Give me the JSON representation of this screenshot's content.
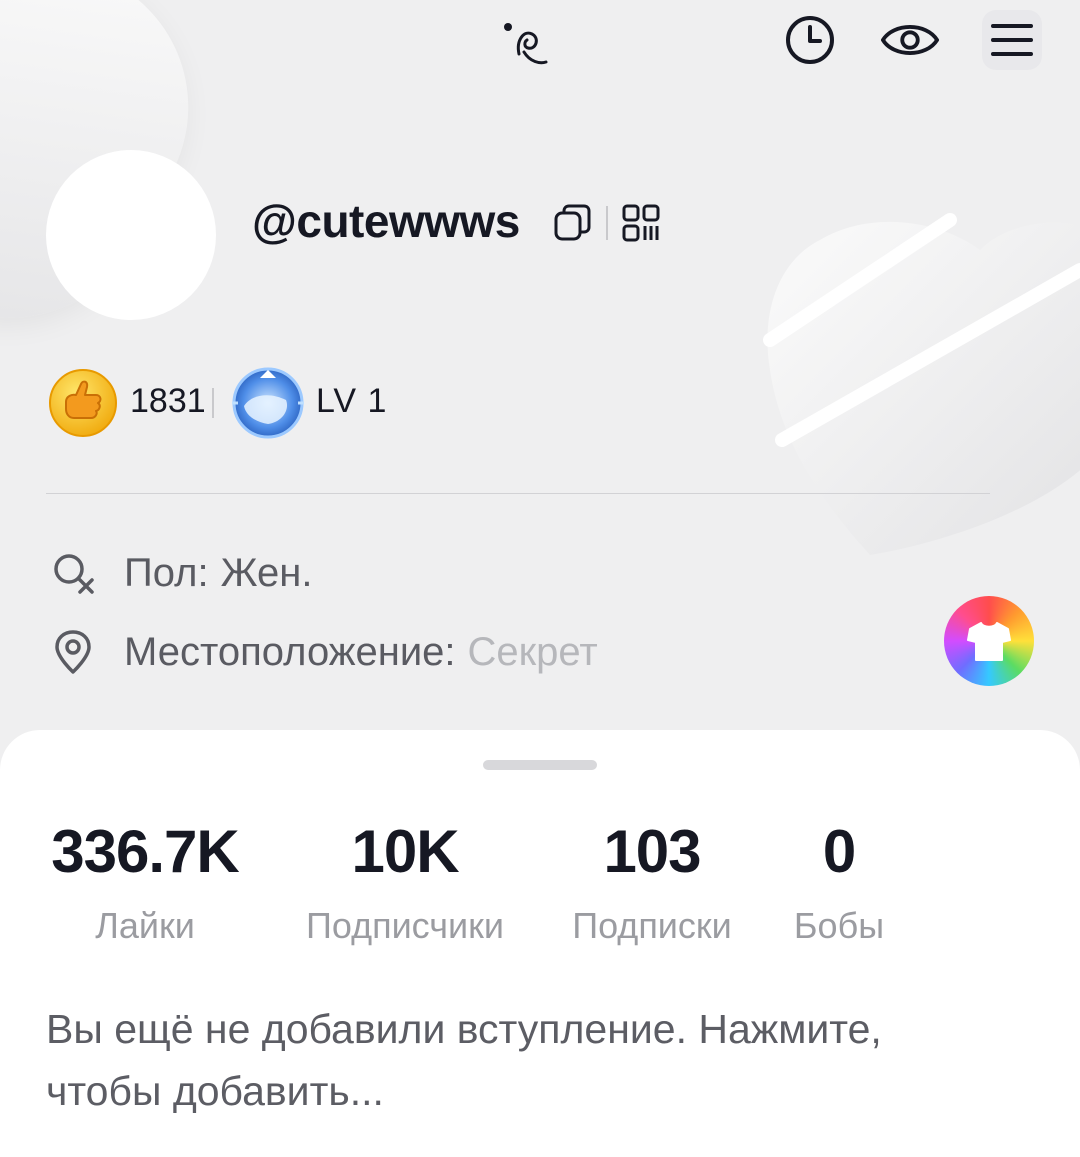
{
  "header": {
    "icons": [
      "activity-icon",
      "history-icon",
      "visitors-eye-icon",
      "menu-icon"
    ]
  },
  "profile": {
    "username": "@cutewwws",
    "coin_count": "1831",
    "level": "LV 1"
  },
  "info": {
    "gender_label": "Пол:",
    "gender_value": "Жен.",
    "location_label": "Местоположение:",
    "location_value": "Секрет"
  },
  "stats": [
    {
      "value": "336.7K",
      "label": "Лайки"
    },
    {
      "value": "10K",
      "label": "Подписчики"
    },
    {
      "value": "103",
      "label": "Подписки"
    },
    {
      "value": "0",
      "label": "Бобы"
    }
  ],
  "bio": {
    "text": "Вы ещё не добавили вступление. Нажмите, чтобы добавить..."
  },
  "colors": {
    "text_primary": "#161823",
    "text_secondary": "#9b9ca1",
    "background": "#efeff0",
    "sheet": "#ffffff",
    "coin": "#f5b915"
  }
}
